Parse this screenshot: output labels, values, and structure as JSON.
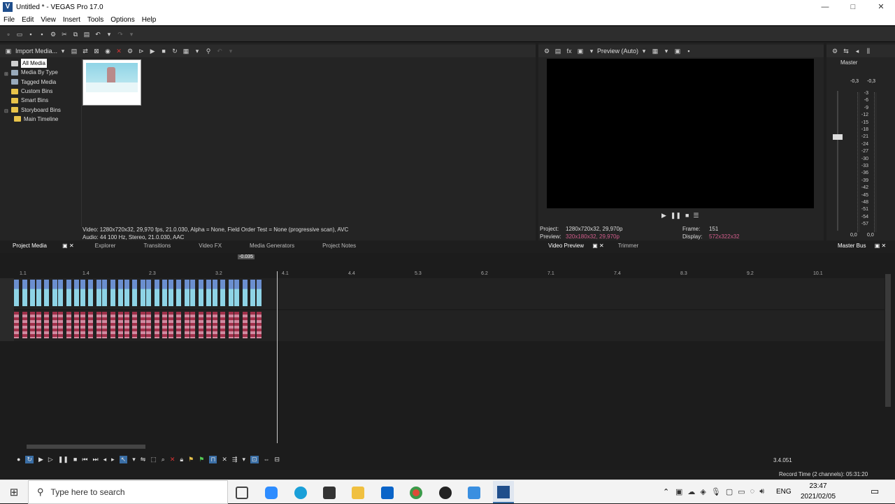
{
  "window": {
    "title": "Untitled * - VEGAS Pro 17.0",
    "icon": "V",
    "minimize": "—",
    "maximize": "□",
    "close": "✕"
  },
  "menu": [
    "File",
    "Edit",
    "View",
    "Insert",
    "Tools",
    "Options",
    "Help"
  ],
  "media_panel": {
    "import_label": "Import Media...",
    "tree": [
      "All Media",
      "Media By Type",
      "Tagged Media",
      "Custom Bins",
      "Smart Bins",
      "Storyboard Bins",
      "Main Timeline"
    ],
    "thumb_caption": "",
    "info_line1": "Video: 1280x720x32, 29,970 fps, 21.0.030, Alpha = None, Field Order Test = None (progressive scan), AVC",
    "info_line2": "Audio: 44 100 Hz, Stereo, 21.0.030, AAC"
  },
  "bottom_tabs": [
    "Project Media",
    "Explorer",
    "Transitions",
    "Video FX",
    "Media Generators",
    "Project Notes"
  ],
  "preview": {
    "mode_label": "Preview (Auto)",
    "project_label": "Project:",
    "project_value": "1280x720x32, 29,970p",
    "preview_label": "Preview:",
    "preview_value": "320x180x32, 29,970p",
    "frame_label": "Frame:",
    "frame_value": "151",
    "display_label": "Display:",
    "display_value": "572x322x32",
    "tabs": [
      "Video Preview",
      "Trimmer"
    ]
  },
  "master": {
    "label": "Master",
    "left_level": "-0,3",
    "right_level": "-0,3",
    "scale": [
      "3",
      "6",
      "9",
      "12",
      "15",
      "18",
      "21",
      "24",
      "27",
      "30",
      "33",
      "36",
      "39",
      "42",
      "45",
      "48",
      "51",
      "54",
      "57"
    ],
    "bottom_left": "0,0",
    "bottom_right": "0,0",
    "tab": "Master Bus"
  },
  "timeline": {
    "cursor_time": "-0.035",
    "ruler": [
      "1.1",
      "1.4",
      "2.3",
      "3.2",
      "4.1",
      "4.4",
      "5.3",
      "6.2",
      "7.1",
      "7.4",
      "8.3",
      "9.2",
      "10.1"
    ],
    "position": "3.4.051",
    "record_time": "Record Time (2 channels): 05:31:20"
  },
  "taskbar": {
    "search_placeholder": "Type here to search",
    "lang": "ENG",
    "time": "23:47",
    "date": "2021/02/05"
  }
}
